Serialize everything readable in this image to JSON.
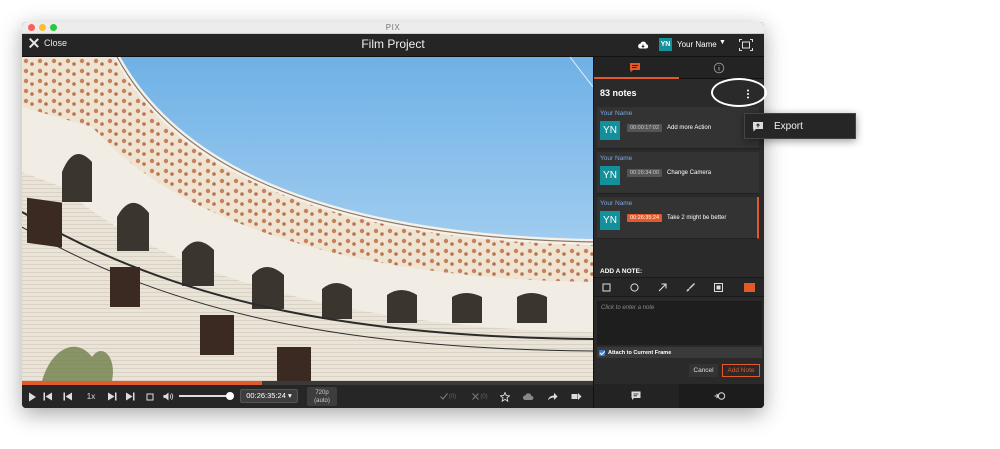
{
  "window": {
    "title": "PIX"
  },
  "appbar": {
    "close_label": "Close",
    "project_title": "Film Project",
    "user_initials": "YN",
    "user_name": "Your Name",
    "caret": "▼"
  },
  "player": {
    "progress": 0.42,
    "speed": "1x",
    "timecode": "00:26:35:24 ▾",
    "resolution_line1": "720p",
    "resolution_line2": "(auto)",
    "approve_count": "(0)",
    "reject_count": "(0)"
  },
  "panel": {
    "notes_count": "83 notes",
    "notes": [
      {
        "author": "Your Name",
        "initials": "YN",
        "timecode": "00:00:17:02",
        "text": "Add more Action",
        "selected": false
      },
      {
        "author": "Your Name",
        "initials": "YN",
        "timecode": "00:26:34:00",
        "text": "Change Camera",
        "selected": false
      },
      {
        "author": "Your Name",
        "initials": "YN",
        "timecode": "00:26:35:24",
        "text": "Take 2 might be better",
        "selected": true
      }
    ],
    "add_note_label": "ADD A NOTE:",
    "note_placeholder": "Click to enter a note",
    "attach_label": "Attach to Current Frame",
    "cancel_label": "Cancel",
    "add_label": "Add Note",
    "accent_color": "#e25a2a"
  },
  "menu": {
    "export_label": "Export"
  }
}
